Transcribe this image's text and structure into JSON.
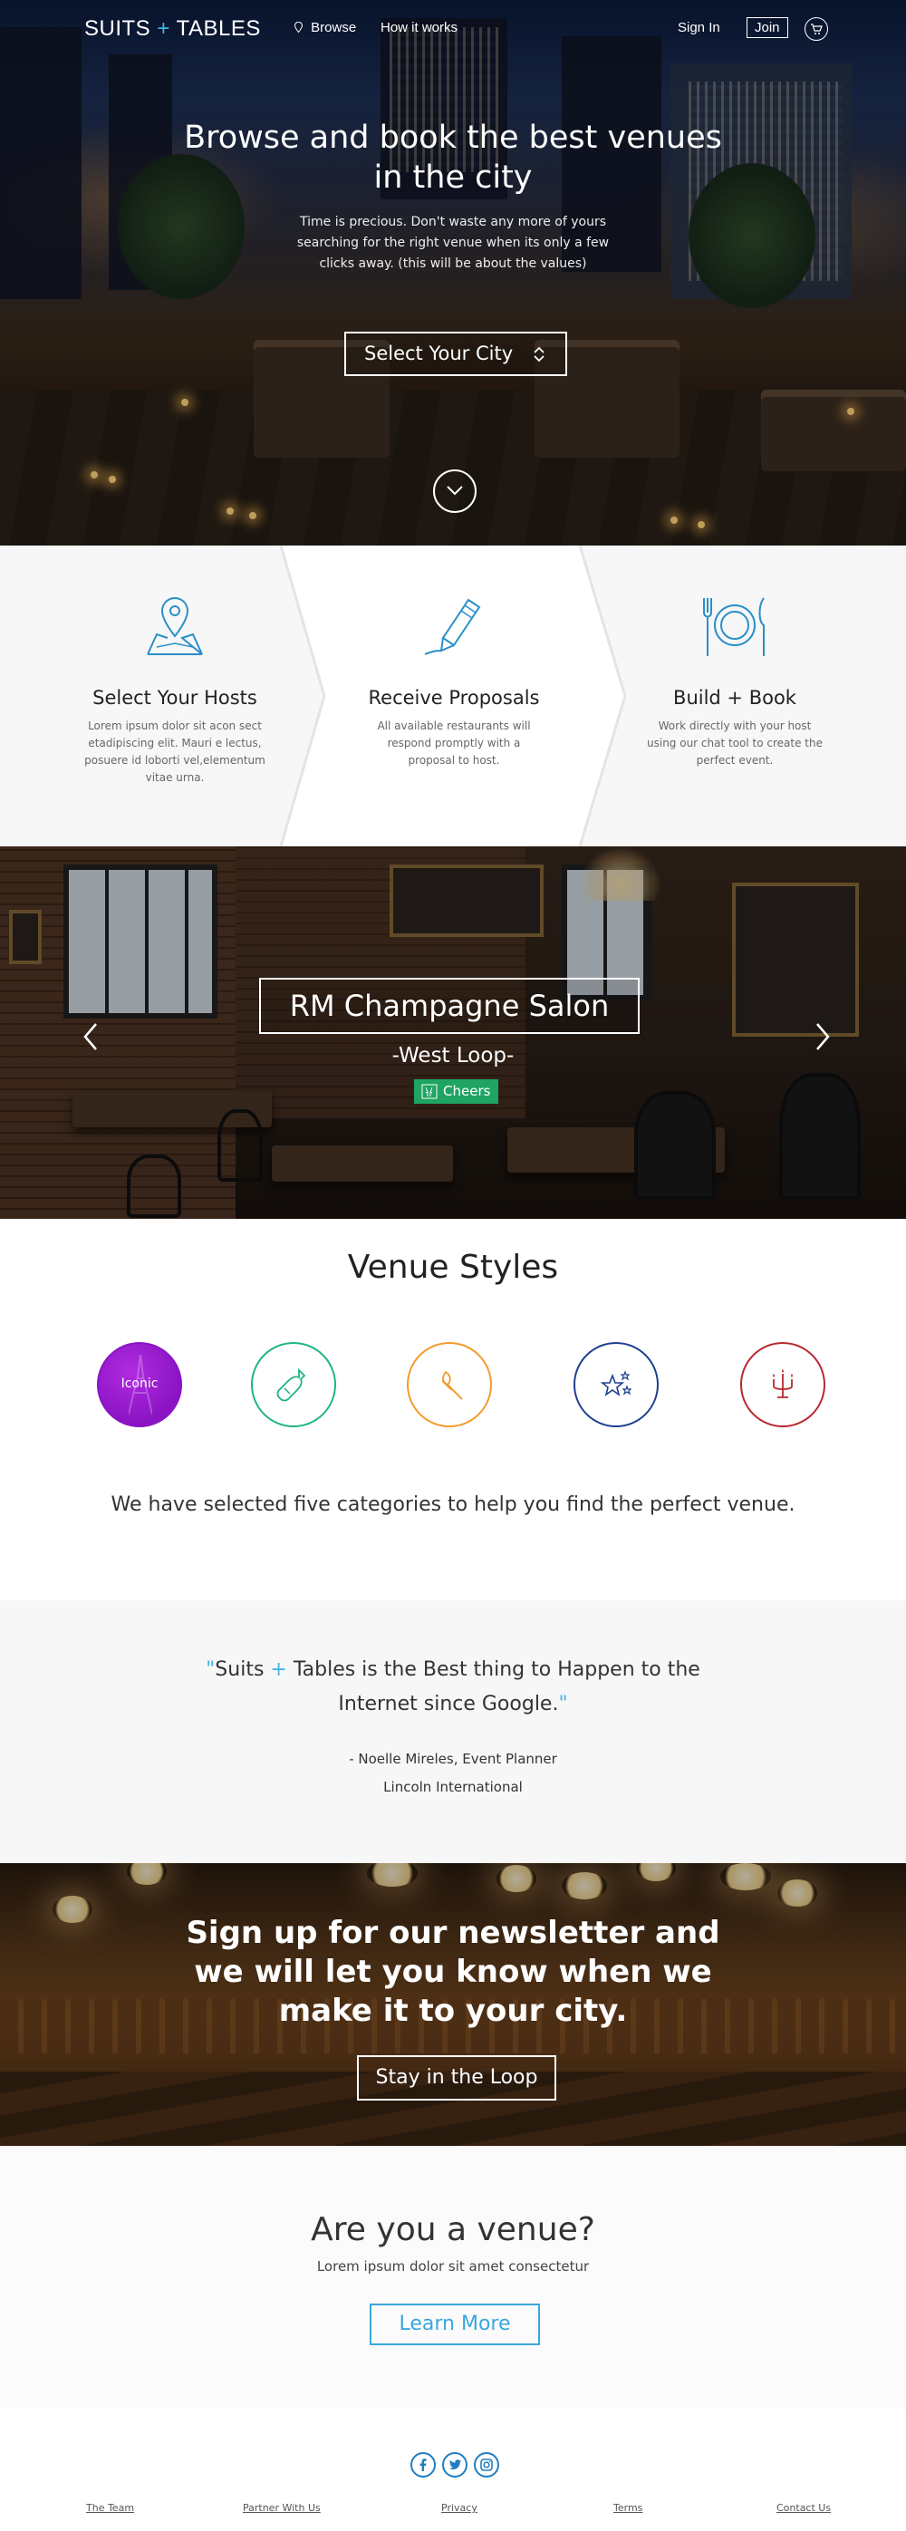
{
  "nav": {
    "logo_left": "SUITS",
    "logo_plus": "+",
    "logo_right": "TABLES",
    "browse": "Browse",
    "how_it_works": "How it works",
    "sign_in": "Sign In",
    "join": "Join"
  },
  "hero": {
    "title": "Browse and book the best venues in the city",
    "subtitle": "Time is precious. Don't waste any more of yours searching for the right venue when its only a few clicks away.  (this will be about the values)",
    "city_select": "Select Your City"
  },
  "steps": [
    {
      "title": "Select Your Hosts",
      "text": "Lorem ipsum dolor sit acon sect etadipiscing elit. Mauri e lectus, posuere id loborti vel,elementum vitae urna."
    },
    {
      "title": "Receive Proposals",
      "text": "All available restaurants will respond promptly with a proposal to host."
    },
    {
      "title": "Build + Book",
      "text": "Work directly with your host using our chat tool to create the perfect event."
    }
  ],
  "featured": {
    "name": "RM Champagne Salon",
    "area": "-West Loop-",
    "badge": "Cheers"
  },
  "venue_styles": {
    "title": "Venue Styles",
    "items": [
      {
        "label": "Iconic",
        "color": "#8a14c4"
      },
      {
        "label": "",
        "color": "#1db584"
      },
      {
        "label": "",
        "color": "#f39a2b"
      },
      {
        "label": "",
        "color": "#1e3f8f"
      },
      {
        "label": "",
        "color": "#b8282e"
      }
    ],
    "description": "We have selected five categories to help you find the perfect venue."
  },
  "testimonial": {
    "open_quote": "\"",
    "line_a": "Suits ",
    "plus": "+",
    "line_b": " Tables is the Best thing to Happen to the Internet since Google.",
    "close_quote": "\"",
    "author": "- Noelle Mireles, Event Planner",
    "organization": "Lincoln International"
  },
  "newsletter": {
    "title": "Sign up for our newsletter and we will let you know when we make it to your city.",
    "button": "Stay in the Loop"
  },
  "venue_cta": {
    "title": "Are you a venue?",
    "subtitle": "Lorem ipsum dolor sit amet consectetur",
    "button": "Learn More"
  },
  "footer": {
    "links": [
      "The Team",
      "Partner With Us",
      "Privacy",
      "Terms",
      "Contact Us"
    ],
    "social": [
      "facebook-icon",
      "twitter-icon",
      "instagram-icon"
    ]
  },
  "colors": {
    "accent": "#45b4e6",
    "step_icon": "#2a8fc9",
    "badge_green": "#1fa463",
    "cta_blue": "#3aa7dd",
    "social_blue": "#1f7ec2"
  }
}
